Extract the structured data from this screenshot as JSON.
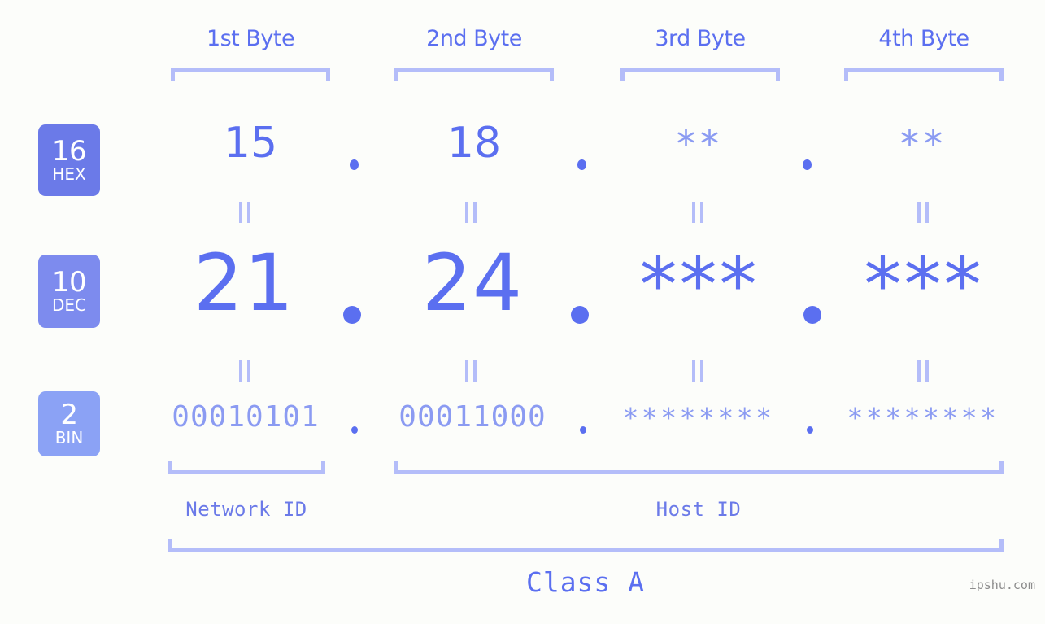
{
  "meta": {
    "background_color": "#fcfdfa",
    "accent_color": "#5b6ff0",
    "accent_light_color": "#b4bdf9",
    "badge_colors": [
      "#6b7ae8",
      "#7d8bee",
      "#8ba2f5"
    ],
    "watermark": "ipshu.com"
  },
  "header": {
    "byte_labels": [
      {
        "label": "1st Byte"
      },
      {
        "label": "2nd Byte"
      },
      {
        "label": "3rd Byte"
      },
      {
        "label": "4th Byte"
      }
    ]
  },
  "radix_badges": [
    {
      "number": "16",
      "system": "HEX"
    },
    {
      "number": "10",
      "system": "DEC"
    },
    {
      "number": "2",
      "system": "BIN"
    }
  ],
  "rows": {
    "hex": {
      "values": [
        "15",
        "18",
        "**",
        "**"
      ],
      "separators": [
        ".",
        ".",
        "."
      ]
    },
    "dec": {
      "values": [
        "21",
        "24",
        "***",
        "***"
      ],
      "separators": [
        ".",
        ".",
        "."
      ]
    },
    "bin": {
      "values": [
        "00010101",
        "00011000",
        "********",
        "********"
      ],
      "separators": [
        ".",
        ".",
        "."
      ]
    }
  },
  "equality_marks": {
    "symbol": "||",
    "upper_count": 4,
    "lower_count": 4
  },
  "footer": {
    "network_id_label": "Network ID",
    "host_id_label": "Host ID",
    "class_label": "Class A"
  }
}
